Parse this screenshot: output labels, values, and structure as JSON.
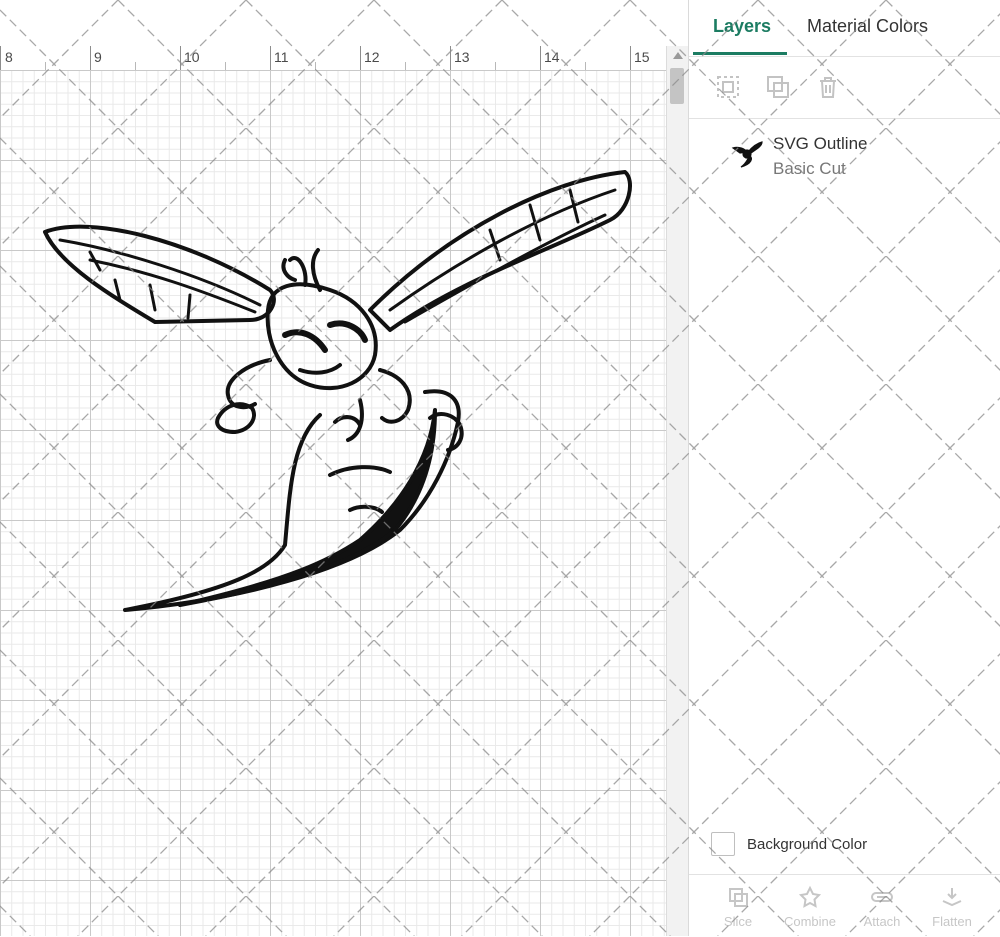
{
  "ruler": {
    "labels": [
      "8",
      "9",
      "10",
      "11",
      "12",
      "13",
      "14",
      "15"
    ]
  },
  "panel": {
    "tabs": {
      "layers": "Layers",
      "material_colors": "Material Colors"
    },
    "toolbar": {
      "icons": [
        "group-icon",
        "duplicate-icon",
        "delete-icon"
      ]
    },
    "layer": {
      "name": "SVG Outline",
      "operation": "Basic Cut"
    },
    "background": {
      "label": "Background Color"
    },
    "bottom_actions": [
      {
        "label": "Slice",
        "icon": "slice-icon"
      },
      {
        "label": "Combine",
        "icon": "combine-icon"
      },
      {
        "label": "Attach",
        "icon": "attach-icon"
      },
      {
        "label": "Flatten",
        "icon": "flatten-icon"
      }
    ]
  },
  "colors": {
    "accent": "#1c7c62",
    "grid_major": "#c9c9c9",
    "grid_minor": "#e9e9e9"
  }
}
